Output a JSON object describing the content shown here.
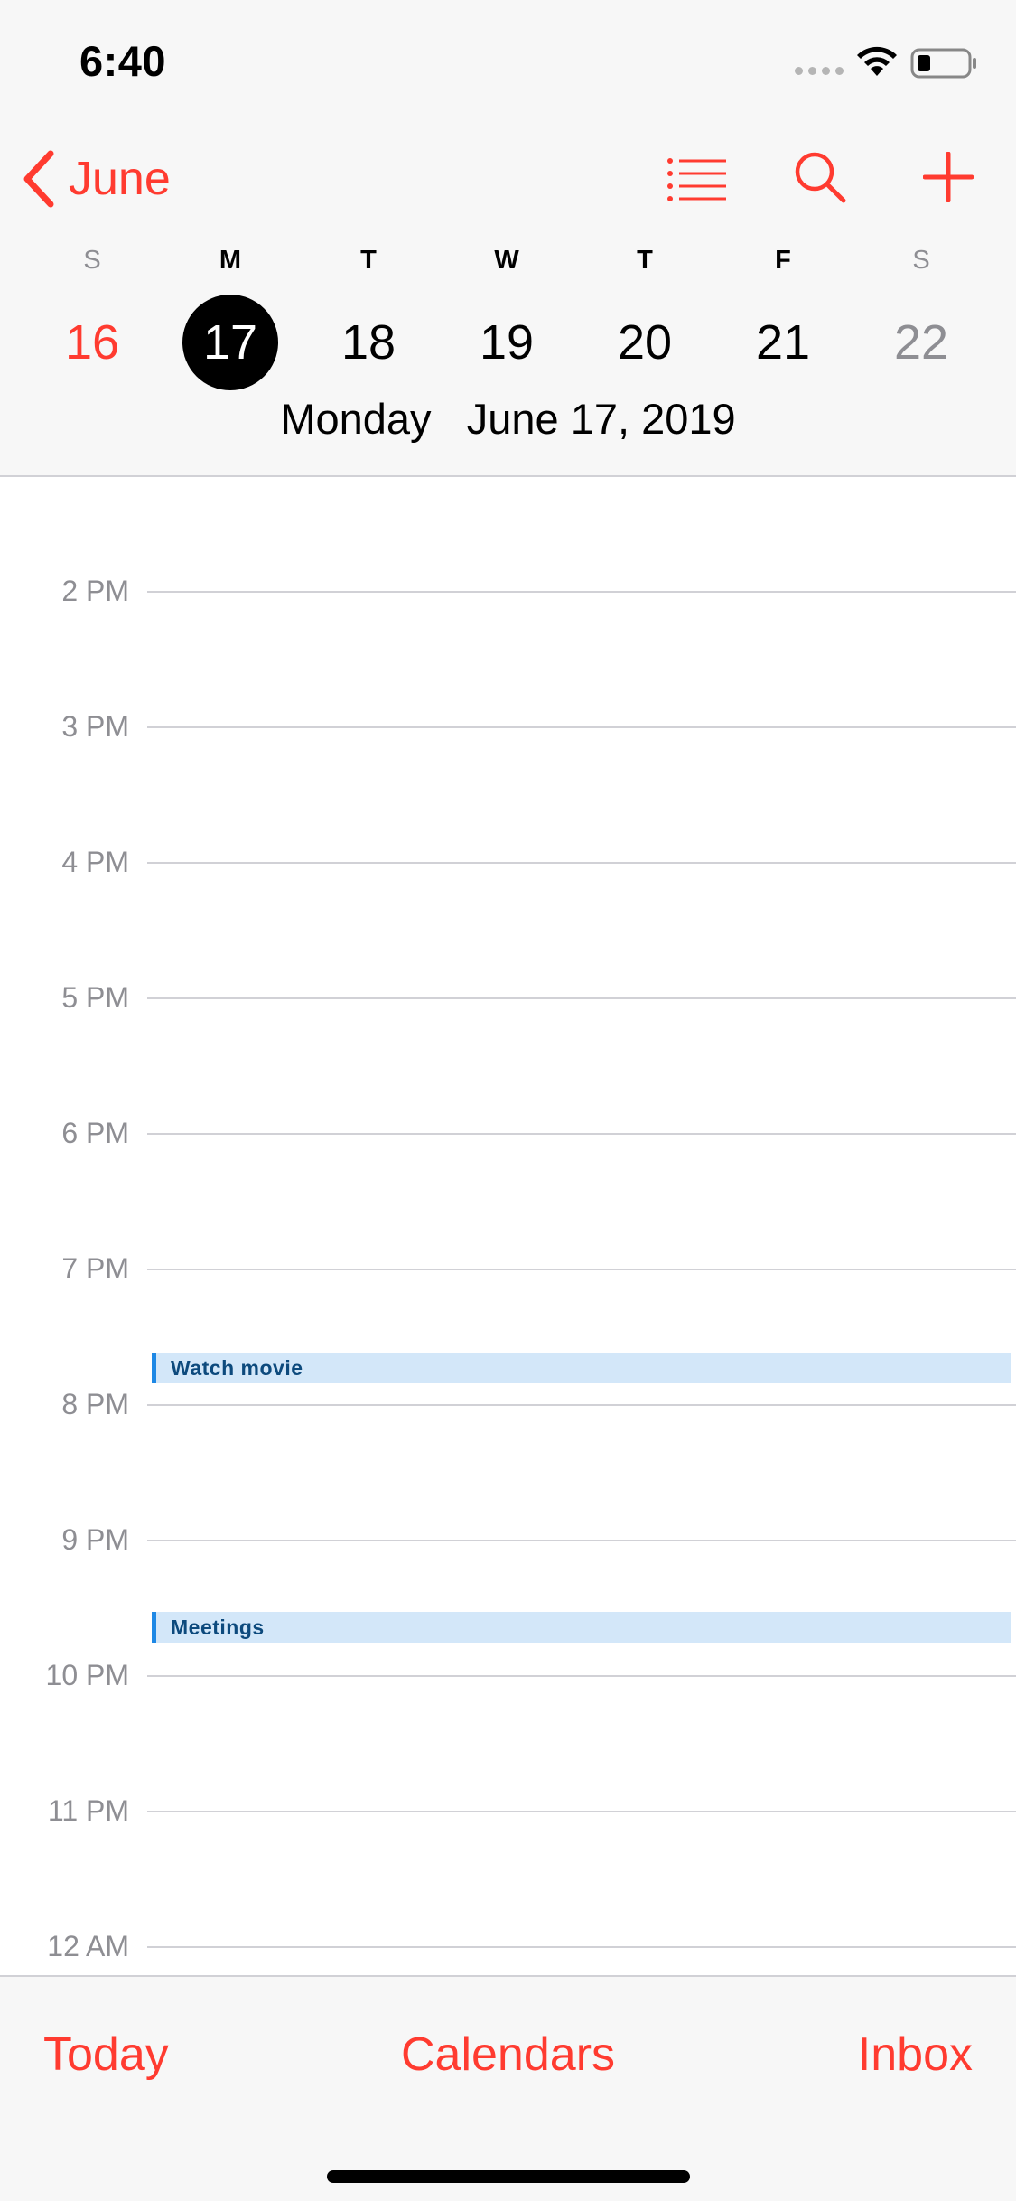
{
  "status_bar": {
    "time": "6:40"
  },
  "nav": {
    "back_label": "June",
    "icons": [
      "list-icon",
      "search-icon",
      "plus-icon"
    ]
  },
  "week": {
    "letters": [
      "S",
      "M",
      "T",
      "W",
      "T",
      "F",
      "S"
    ],
    "days": [
      "16",
      "17",
      "18",
      "19",
      "20",
      "21",
      "22"
    ],
    "selected_day": "17",
    "selected_weekday": "Monday",
    "selected_date": "June 17, 2019"
  },
  "timeline": {
    "hours": [
      "2 PM",
      "3 PM",
      "4 PM",
      "5 PM",
      "6 PM",
      "7 PM",
      "8 PM",
      "9 PM",
      "10 PM",
      "11 PM",
      "12 AM"
    ],
    "events": [
      {
        "title": "Watch movie"
      },
      {
        "title": "Meetings"
      }
    ]
  },
  "tabbar": {
    "today": "Today",
    "calendars": "Calendars",
    "inbox": "Inbox"
  },
  "colors": {
    "accent": "#ff3b30",
    "event_fill": "#d3e7f9",
    "event_bar": "#1e88e5",
    "event_text": "#0d4a7d",
    "secondary_text": "#8e8e93"
  }
}
